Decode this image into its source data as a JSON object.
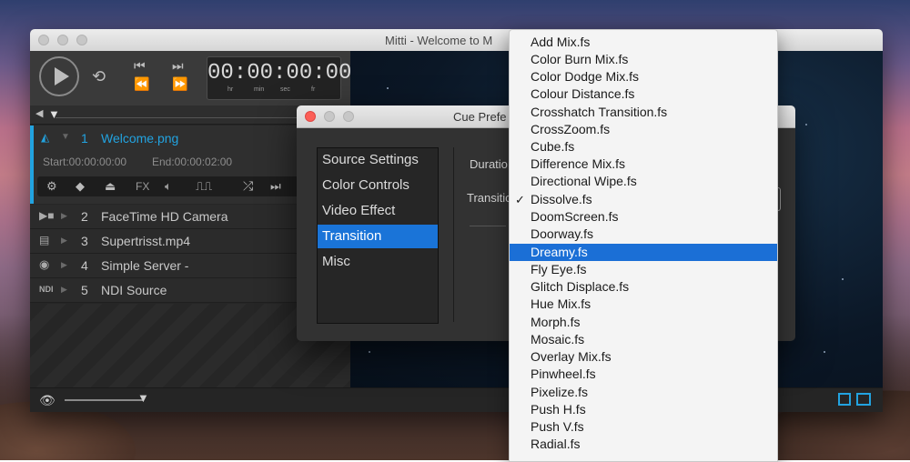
{
  "window": {
    "title": "Mitti - Welcome to M"
  },
  "transport": {
    "timecode": "00:00:00:00",
    "tc_labels": [
      "hr",
      "min",
      "sec",
      "fr"
    ]
  },
  "cues": {
    "selected": {
      "number": "1",
      "name": "Welcome.png",
      "start": "Start:00:00:00:00",
      "end": "End:00:00:02:00"
    },
    "cue_tools": [
      "FX"
    ],
    "rows": [
      {
        "icon": "camera-icon",
        "badge": "",
        "number": "2",
        "name": "FaceTime HD Camera"
      },
      {
        "icon": "film-icon",
        "badge": "",
        "number": "3",
        "name": "Supertrisst.mp4"
      },
      {
        "icon": "server-icon",
        "badge": "",
        "number": "4",
        "name": "Simple Server -"
      },
      {
        "icon": "ndi-icon",
        "badge": "NDI",
        "number": "5",
        "name": "NDI Source"
      }
    ]
  },
  "dialog": {
    "title": "Cue Prefe",
    "items": [
      "Source Settings",
      "Color Controls",
      "Video Effect",
      "Transition",
      "Misc"
    ],
    "selected_index": 3,
    "labels": {
      "duration": "Duratio",
      "transition": "Transitio"
    }
  },
  "menu": {
    "items": [
      "Add Mix.fs",
      "Color Burn Mix.fs",
      "Color Dodge Mix.fs",
      "Colour Distance.fs",
      "Crosshatch Transition.fs",
      "CrossZoom.fs",
      "Cube.fs",
      "Difference Mix.fs",
      "Directional Wipe.fs",
      "Dissolve.fs",
      "DoomScreen.fs",
      "Doorway.fs",
      "Dreamy.fs",
      "Fly Eye.fs",
      "Glitch Displace.fs",
      "Hue Mix.fs",
      "Morph.fs",
      "Mosaic.fs",
      "Overlay Mix.fs",
      "Pinwheel.fs",
      "Pixelize.fs",
      "Push H.fs",
      "Push V.fs",
      "Radial.fs"
    ],
    "checked": "Dissolve.fs",
    "highlighted": "Dreamy.fs"
  },
  "colors": {
    "accent": "#22a3e0",
    "selection": "#1a74d8",
    "menu_highlight": "#1b6fd6"
  }
}
